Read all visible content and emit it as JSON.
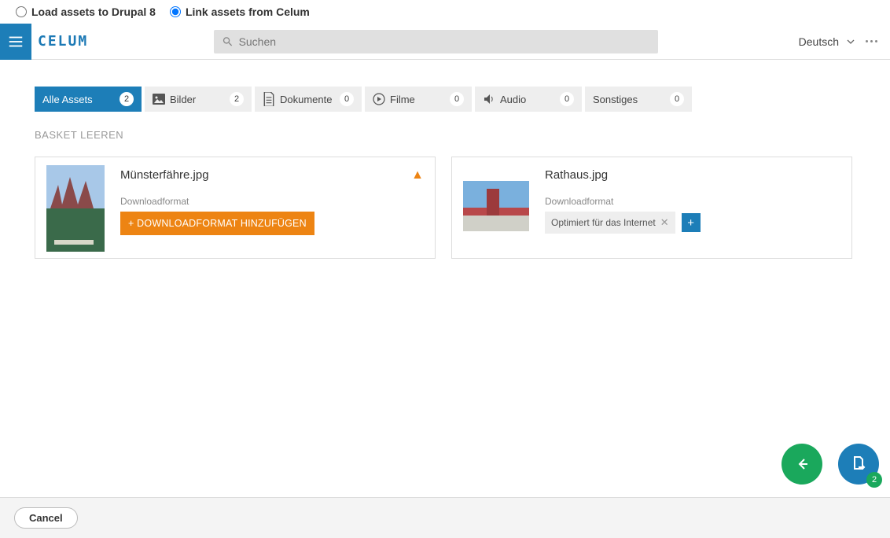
{
  "options": {
    "load": "Load assets to Drupal 8",
    "link": "Link assets from Celum"
  },
  "logo": "CELUM",
  "search": {
    "placeholder": "Suchen"
  },
  "lang": "Deutsch",
  "tabs": [
    {
      "label": "Alle Assets",
      "count": "2"
    },
    {
      "label": "Bilder",
      "count": "2"
    },
    {
      "label": "Dokumente",
      "count": "0"
    },
    {
      "label": "Filme",
      "count": "0"
    },
    {
      "label": "Audio",
      "count": "0"
    },
    {
      "label": "Sonstiges",
      "count": "0"
    }
  ],
  "basket_clear": "BASKET LEEREN",
  "cards": [
    {
      "title": "Münsterfähre.jpg",
      "sub": "Downloadformat",
      "add_label": "+ DOWNLOADFORMAT HINZUFÜGEN"
    },
    {
      "title": "Rathaus.jpg",
      "sub": "Downloadformat",
      "chip": "Optimiert für das Internet"
    }
  ],
  "fab_badge": "2",
  "footer": {
    "cancel": "Cancel"
  }
}
